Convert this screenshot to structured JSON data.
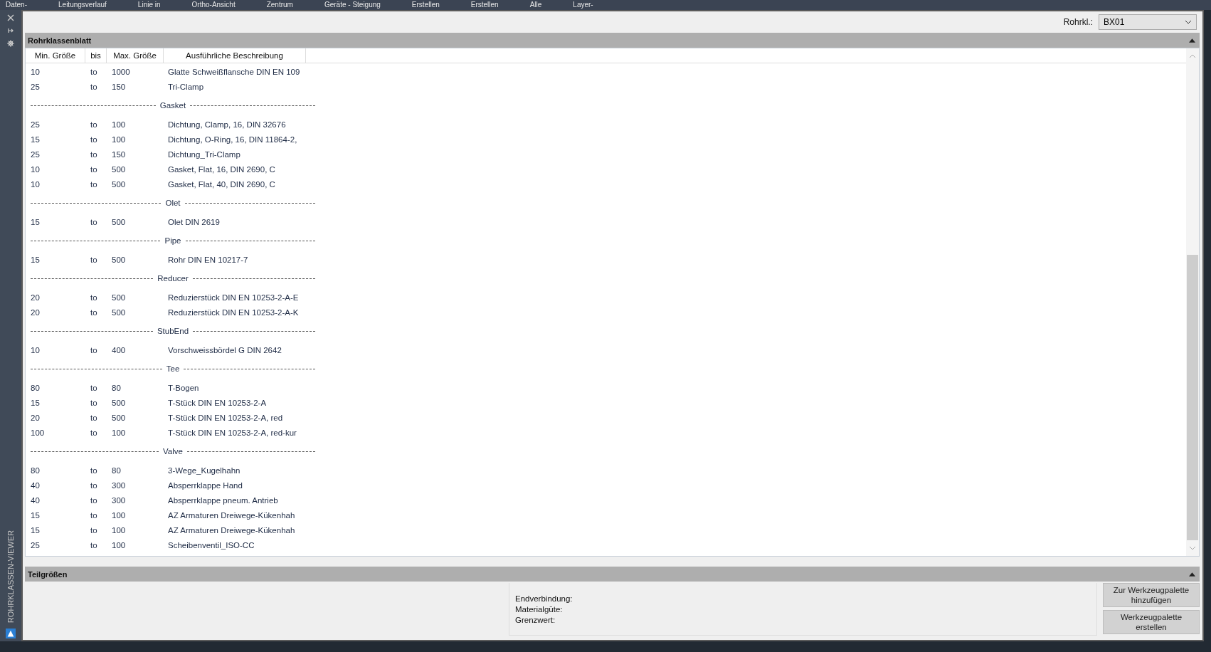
{
  "background_toolbar": {
    "labels": [
      "Daten-",
      "Leitungsverlauf",
      "Linie in",
      "Ortho-Ansicht",
      "Zentrum",
      "Geräte - Steigung",
      "Erstellen",
      "Erstellen",
      "Alle",
      "Layer-"
    ]
  },
  "palette": {
    "title": "ROHRKLASSEN-VIEWER"
  },
  "pipe_class": {
    "label": "Rohrkl.:",
    "value": "BX01"
  },
  "sheet": {
    "title": "Rohrklassenblatt",
    "expanded": true,
    "columns": [
      "Min. Größe",
      "bis",
      "Max. Größe",
      "Ausführliche Beschreibung"
    ],
    "rows": [
      {
        "kind": "item",
        "min": "10",
        "bis": "to",
        "max": "1000",
        "description": "Glatte Schweißflansche DIN EN 109"
      },
      {
        "kind": "item",
        "min": "25",
        "bis": "to",
        "max": "150",
        "description": "Tri-Clamp"
      },
      {
        "kind": "group",
        "name": "Gasket"
      },
      {
        "kind": "item",
        "min": "25",
        "bis": "to",
        "max": "100",
        "description": "Dichtung, Clamp, 16, DIN 32676"
      },
      {
        "kind": "item",
        "min": "15",
        "bis": "to",
        "max": "100",
        "description": "Dichtung, O-Ring, 16, DIN 11864-2,"
      },
      {
        "kind": "item",
        "min": "25",
        "bis": "to",
        "max": "150",
        "description": "Dichtung_Tri-Clamp"
      },
      {
        "kind": "item",
        "min": "10",
        "bis": "to",
        "max": "500",
        "description": "Gasket, Flat, 16, DIN 2690, C"
      },
      {
        "kind": "item",
        "min": "10",
        "bis": "to",
        "max": "500",
        "description": "Gasket, Flat, 40, DIN 2690, C"
      },
      {
        "kind": "group",
        "name": "Olet"
      },
      {
        "kind": "item",
        "min": "15",
        "bis": "to",
        "max": "500",
        "description": "Olet DIN 2619"
      },
      {
        "kind": "group",
        "name": "Pipe"
      },
      {
        "kind": "item",
        "min": "15",
        "bis": "to",
        "max": "500",
        "description": "Rohr DIN EN 10217-7"
      },
      {
        "kind": "group",
        "name": "Reducer"
      },
      {
        "kind": "item",
        "min": "20",
        "bis": "to",
        "max": "500",
        "description": "Reduzierstück DIN EN 10253-2-A-E"
      },
      {
        "kind": "item",
        "min": "20",
        "bis": "to",
        "max": "500",
        "description": "Reduzierstück DIN EN 10253-2-A-K"
      },
      {
        "kind": "group",
        "name": "StubEnd"
      },
      {
        "kind": "item",
        "min": "10",
        "bis": "to",
        "max": "400",
        "description": "Vorschweissbördel G DIN 2642"
      },
      {
        "kind": "group",
        "name": "Tee"
      },
      {
        "kind": "item",
        "min": "80",
        "bis": "to",
        "max": "80",
        "description": "T-Bogen"
      },
      {
        "kind": "item",
        "min": "15",
        "bis": "to",
        "max": "500",
        "description": "T-Stück DIN EN 10253-2-A"
      },
      {
        "kind": "item",
        "min": "20",
        "bis": "to",
        "max": "500",
        "description": "T-Stück DIN EN 10253-2-A, red"
      },
      {
        "kind": "item",
        "min": "100",
        "bis": "to",
        "max": "100",
        "description": "T-Stück DIN EN 10253-2-A, red-kur"
      },
      {
        "kind": "group",
        "name": "Valve"
      },
      {
        "kind": "item",
        "min": "80",
        "bis": "to",
        "max": "80",
        "description": "3-Wege_Kugelhahn"
      },
      {
        "kind": "item",
        "min": "40",
        "bis": "to",
        "max": "300",
        "description": "Absperrklappe Hand"
      },
      {
        "kind": "item",
        "min": "40",
        "bis": "to",
        "max": "300",
        "description": "Absperrklappe pneum. Antrieb"
      },
      {
        "kind": "item",
        "min": "15",
        "bis": "to",
        "max": "100",
        "description": "AZ Armaturen Dreiwege-Kükenhah"
      },
      {
        "kind": "item",
        "min": "15",
        "bis": "to",
        "max": "100",
        "description": "AZ Armaturen Dreiwege-Kükenhah"
      },
      {
        "kind": "item",
        "min": "25",
        "bis": "to",
        "max": "100",
        "description": "Scheibenventil_ISO-CC"
      }
    ]
  },
  "part_sizes": {
    "title": "Teilgrößen",
    "expanded": true,
    "fields": [
      "Endverbindung:",
      "Materialgüte:",
      "Grenzwert:"
    ],
    "buttons": [
      "Zur Werkzeugpalette hinzufügen",
      "Werkzeugpalette erstellen"
    ]
  }
}
